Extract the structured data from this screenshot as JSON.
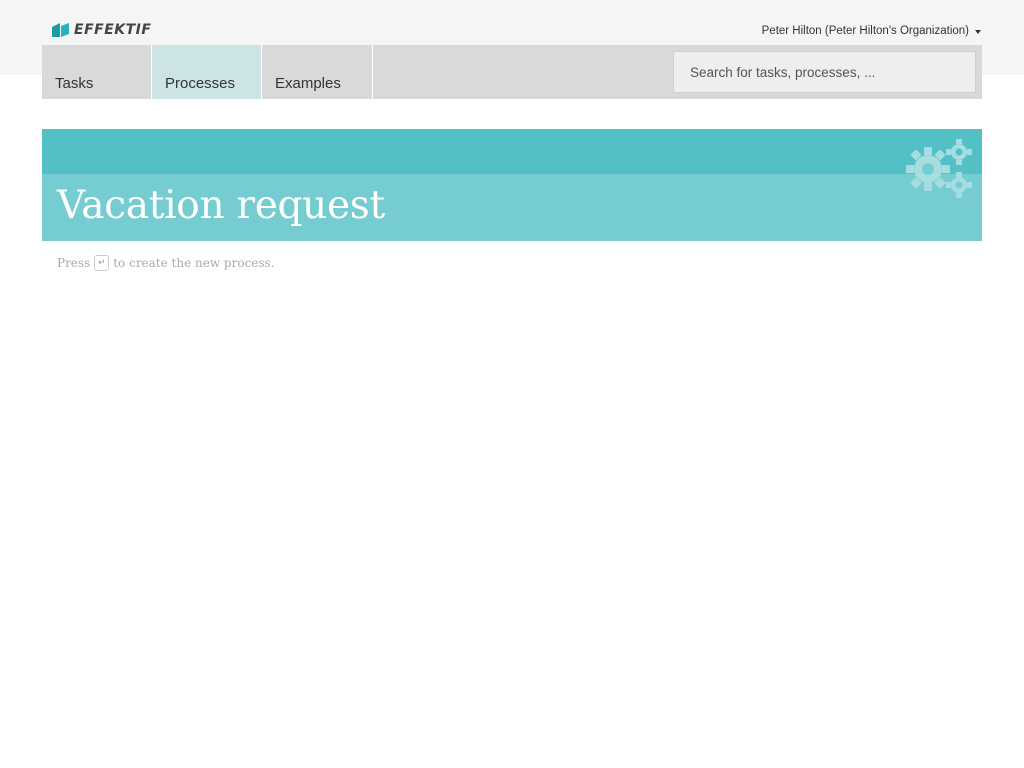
{
  "brand": {
    "logo_text": "effektif"
  },
  "header": {
    "user_menu_label": "Peter Hilton (Peter Hilton's Organization)"
  },
  "nav": {
    "tabs": [
      {
        "label": "Tasks",
        "active": false
      },
      {
        "label": "Processes",
        "active": true
      },
      {
        "label": "Examples",
        "active": false
      }
    ]
  },
  "search": {
    "placeholder": "Search for tasks, processes, ..."
  },
  "banner": {
    "title": "Vacation request",
    "icon": "gears-icon"
  },
  "hint": {
    "before": "Press",
    "key": "↵",
    "after": "to create the new process."
  },
  "colors": {
    "accent_dark": "#52c0c5",
    "accent_light": "#75cdd1",
    "active_tab": "#cde4e6",
    "logo_mark": "#1a9aa8"
  }
}
